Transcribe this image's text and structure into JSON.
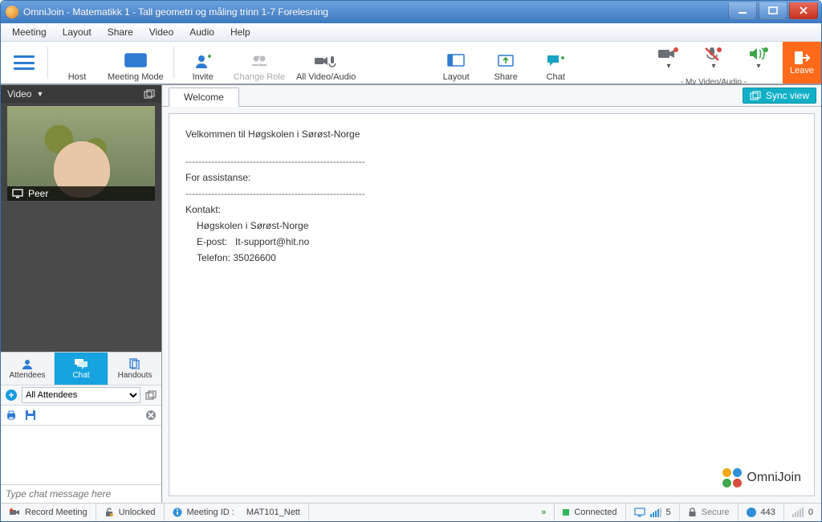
{
  "window": {
    "title": "OmniJoin - Matematikk 1 - Tall  geometri og måling  trinn 1-7  Forelesning"
  },
  "menu": {
    "items": [
      "Meeting",
      "Layout",
      "Share",
      "Video",
      "Audio",
      "Help"
    ]
  },
  "toolbar": {
    "hamburger": "menu",
    "host": "Host",
    "meeting_mode": "Meeting Mode",
    "invite": "Invite",
    "change_role": "Change Role",
    "all_va": "All Video/Audio",
    "layout": "Layout",
    "share": "Share",
    "chat": "Chat",
    "my_va": "- My Video/Audio -",
    "leave": "Leave"
  },
  "video_panel": {
    "title": "Video",
    "participant": "Peer"
  },
  "left_tabs": {
    "attendees": "Attendees",
    "chat": "Chat",
    "handouts": "Handouts"
  },
  "chat": {
    "target": "All Attendees",
    "placeholder": "Type chat message here"
  },
  "main": {
    "tab": "Welcome",
    "sync": "Sync view",
    "welcome_line": "Velkommen til Høgskolen i Sørøst-Norge",
    "assistance": "For assistanse:",
    "contact_hdr": "Kontakt:",
    "contact_org": "Høgskolen i Sørøst-Norge",
    "contact_email_l": "E-post:",
    "contact_email_v": "It-support@hit.no",
    "contact_phone_l": "Telefon:",
    "contact_phone_v": "35026600",
    "dashes": "--------------------------------------------------------",
    "brand": "OmniJoin"
  },
  "status": {
    "record": "Record Meeting",
    "unlocked": "Unlocked",
    "meeting_id_label": "Meeting ID :",
    "meeting_id": "MAT101_Nett",
    "connected": "Connected",
    "screens": "5",
    "secure": "Secure",
    "port": "443",
    "net": "0"
  }
}
